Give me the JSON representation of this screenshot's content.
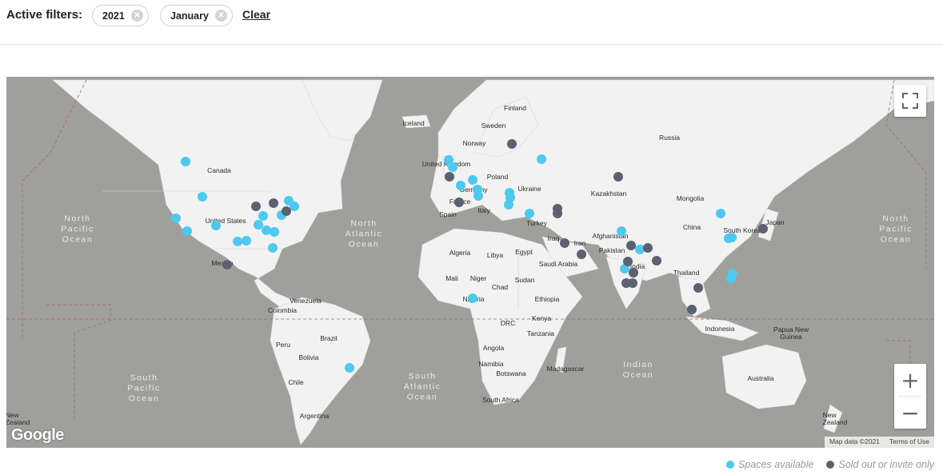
{
  "filters": {
    "label": "Active filters:",
    "chips": [
      {
        "label": "2021"
      },
      {
        "label": "January"
      }
    ],
    "clear_label": "Clear"
  },
  "map": {
    "countries": {
      "finland": "Finland",
      "iceland": "Iceland",
      "sweden": "Sweden",
      "norway": "Norway",
      "russia": "Russia",
      "united_kingdom": "United Kingdom",
      "poland": "Poland",
      "germany": "Germany",
      "ukraine": "Ukraine",
      "france": "France",
      "spain": "Spain",
      "italy": "Italy",
      "kazakhstan": "Kazakhstan",
      "mongolia": "Mongolia",
      "turkey": "Turkey",
      "canada": "Canada",
      "united_states": "United States",
      "mexico": "Mexico",
      "iraq": "Iraq",
      "iran": "Iran",
      "afghanistan": "Afghanistan",
      "china": "China",
      "south_korea": "South Korea",
      "japan": "Japan",
      "pakistan": "Pakistan",
      "india": "India",
      "algeria": "Algeria",
      "libya": "Libya",
      "egypt": "Egypt",
      "saudi_arabia": "Saudi Arabia",
      "mali": "Mali",
      "niger": "Niger",
      "chad": "Chad",
      "sudan": "Sudan",
      "thailand": "Thailand",
      "venezuela": "Venezuela",
      "colombia": "Colombia",
      "nigeria": "Nigeria",
      "ethiopia": "Ethiopia",
      "kenya": "Kenya",
      "drc": "DRC",
      "tanzania": "Tanzania",
      "indonesia": "Indonesia",
      "papua_new_guinea": "Papua New\nGuinea",
      "peru": "Peru",
      "brazil": "Brazil",
      "bolivia": "Bolivia",
      "angola": "Angola",
      "namibia": "Namibia",
      "botswana": "Botswana",
      "madagascar": "Madagascar",
      "chile": "Chile",
      "south_africa": "South Africa",
      "australia": "Australia",
      "argentina": "Argentina",
      "new_zealand_w": "New\nZealand",
      "new_zealand_e": "New\nZealand"
    },
    "oceans": {
      "north_pacific_w": "North\nPacific\nOcean",
      "north_pacific_e": "North\nPacific\nOcean",
      "north_atlantic": "North\nAtlantic\nOcean",
      "south_pacific": "South\nPacific\nOcean",
      "south_atlantic": "South\nAtlantic\nOcean",
      "indian": "Indian\nOcean"
    },
    "fullscreen_icon": "fullscreen-icon",
    "zoom_in_label": "+",
    "zoom_out_label": "−",
    "google_logo": "Google",
    "attribution": "Map data ©2021",
    "terms_label": "Terms of Use",
    "colors": {
      "available": "#4dc9ef",
      "sold_out": "#5b6170",
      "water": "#9f9f9c",
      "land": "#f2f2f2"
    }
  },
  "legend": {
    "available_label": "Spaces available",
    "sold_out_label": "Sold out or invite only"
  }
}
